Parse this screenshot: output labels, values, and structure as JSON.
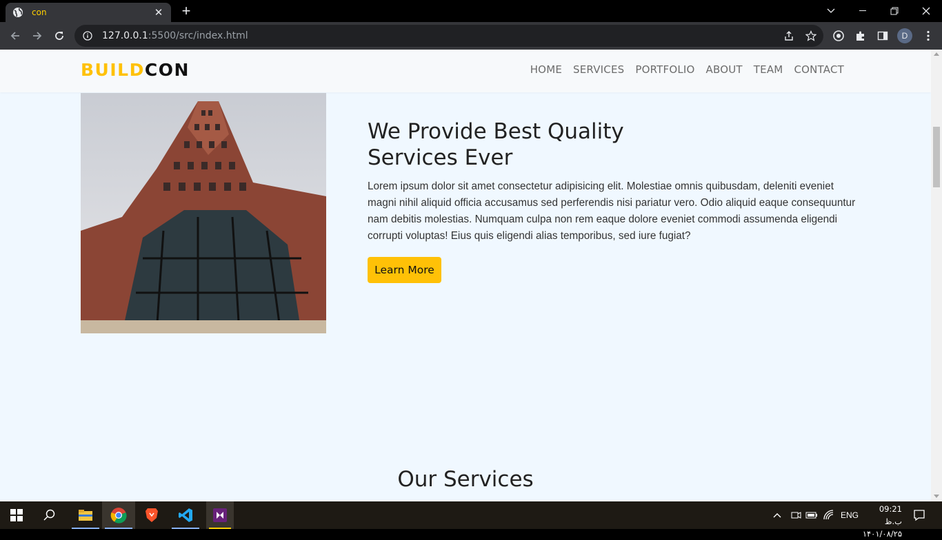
{
  "browser": {
    "tab_title": "con",
    "url_host": "127.0.0.1",
    "url_rest": ":5500/src/index.html",
    "profile_initial": "D"
  },
  "site": {
    "logo_first": "BUILD",
    "logo_second": "CON",
    "nav": [
      "HOME",
      "SERVICES",
      "PORTFOLIO",
      "ABOUT",
      "TEAM",
      "CONTACT"
    ],
    "hero_title_line1": "We Provide Best Quality",
    "hero_title_line2": "Services Ever",
    "hero_text": "Lorem ipsum dolor sit amet consectetur adipisicing elit. Molestiae omnis quibusdam, deleniti eveniet magni nihil aliquid officia accusamus sed perferendis nisi pariatur vero. Odio aliquid eaque consequuntur nam debitis molestias. Numquam culpa non rem eaque dolore eveniet commodi assumenda eligendi corrupti voluptas! Eius quis eligendi alias temporibus, sed iure fugiat?",
    "cta_label": "Learn More",
    "section_title": "Our Services",
    "accent_color": "#ffc107"
  },
  "taskbar": {
    "apps": [
      "start-icon",
      "search-icon",
      "file-explorer-icon",
      "chrome-icon",
      "brave-icon",
      "vscode-icon",
      "visual-studio-icon"
    ],
    "language": "ENG",
    "time": "09:21 ب.ظ",
    "date": "۱۴۰۱/۰۸/۲۵"
  }
}
